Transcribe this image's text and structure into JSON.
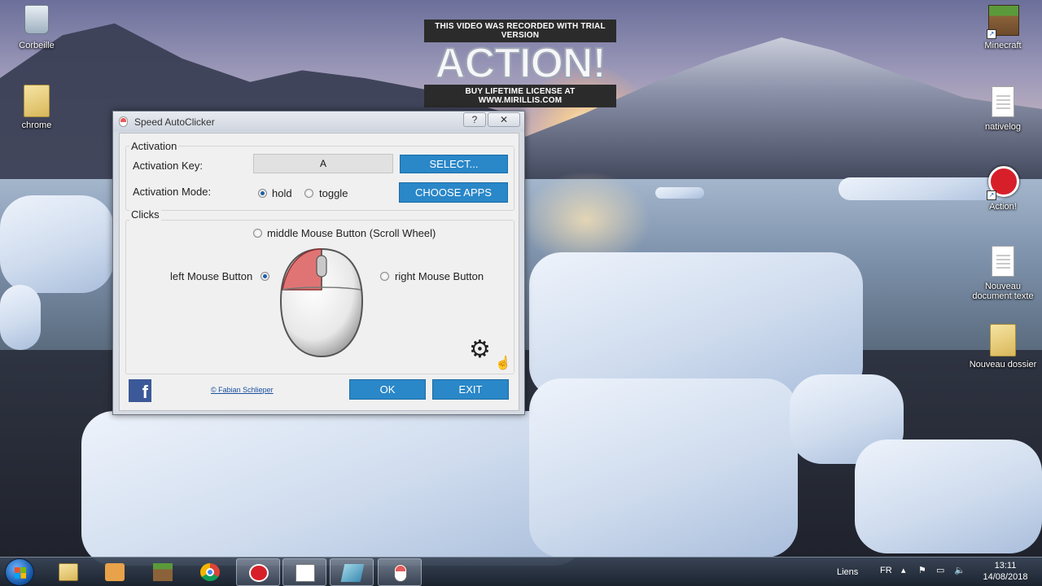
{
  "watermark": {
    "top_text": "THIS VIDEO WAS RECORDED WITH TRIAL VERSION",
    "logo": "ACTION!",
    "bottom_text": "BUY LIFETIME LICENSE AT WWW.MIRILLIS.COM"
  },
  "desktop_icons": {
    "recycle_bin": "Corbeille",
    "chrome": "chrome",
    "minecraft": "Minecraft",
    "nativelog": "nativelog",
    "action": "Action!",
    "new_text_doc": "Nouveau document texte",
    "new_folder": "Nouveau dossier"
  },
  "window": {
    "title": "Speed AutoClicker",
    "help_label": "?",
    "close_label": "✕",
    "activation_group": "Activation",
    "activation_key_label": "Activation Key:",
    "activation_key_value": "A",
    "select_button": "SELECT...",
    "activation_mode_label": "Activation Mode:",
    "mode_hold": "hold",
    "mode_toggle": "toggle",
    "choose_apps_button": "CHOOSE APPS",
    "clicks_group": "Clicks",
    "middle_button": "middle Mouse Button (Scroll Wheel)",
    "left_button": "left Mouse Button",
    "right_button": "right Mouse Button",
    "credit": "© Fabian Schlieper",
    "facebook_glyph": "f",
    "ok_button": "OK",
    "exit_button": "EXIT",
    "selected_mode": "hold",
    "selected_button": "left"
  },
  "taskbar": {
    "links_label": "Liens",
    "language": "FR",
    "time": "13:11",
    "date": "14/08/2018"
  },
  "colors": {
    "accent_blue": "#2a87c8",
    "record_red": "#d71f2a",
    "facebook_blue": "#3b5998"
  }
}
